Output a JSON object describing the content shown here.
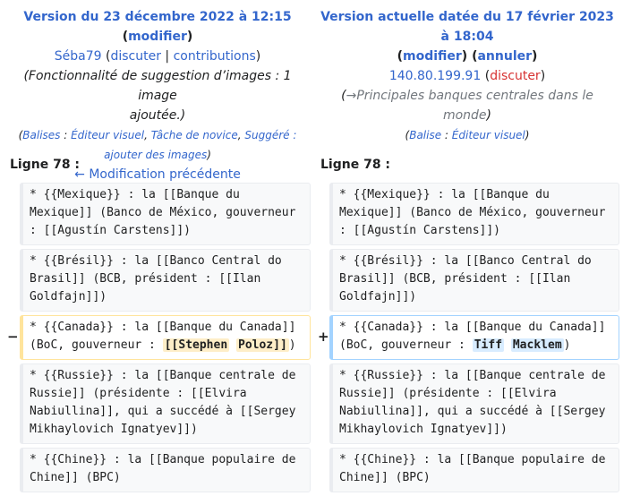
{
  "left": {
    "title_prefix": "Version du 23 décembre 2022 à 12:15",
    "modify": "modifier",
    "user": "Séba79",
    "discuss": "discuter",
    "separator": "|",
    "contributions": "contributions",
    "summary_part1": "(Fonctionnalité de suggestion d’images : 1 image",
    "summary_part2": "ajoutée.)",
    "tag_label": "Balises",
    "tag1": "Éditeur visuel",
    "tag2": "Tâche de novice",
    "tag3": "Suggéré :",
    "tag4": "ajouter des images",
    "prev_link": "← Modification précédente"
  },
  "right": {
    "title": "Version actuelle datée du 17 février 2023 à 18:04",
    "modify": "modifier",
    "undo": "annuler",
    "user": "140.80.199.91",
    "discuss": "discuter",
    "summary_arrow": "→",
    "summary": "Principales banques centrales dans le monde",
    "tag_label": "Balise",
    "tag1": "Éditeur visuel"
  },
  "line_label": "Ligne 78 :",
  "rows": {
    "mexique": "* {{Mexique}} : la [[Banque du Mexique]] (Banco de México, gouverneur : [[Agustín Carstens]])",
    "bresil": "* {{Brésil}} : la [[Banco Central do Brasil]] (BCB, président : [[Ilan Goldfajn]])",
    "canada_prefix": "* {{Canada}} : la [[Banque du Canada]] (BoC, gouverneur : ",
    "canada_old1": "[[Stephen",
    "canada_old2": "Poloz]]",
    "canada_new1": "Tiff",
    "canada_new2": "Macklem",
    "canada_suffix": ")",
    "russie": "* {{Russie}} : la [[Banque centrale de Russie]] (présidente : [[Elvira Nabiullina]], qui a succédé à [[Sergey Mikhaylovich Ignatyev]])",
    "chine": "* {{Chine}} : la [[Banque populaire de Chine]] (BPC)"
  },
  "markers": {
    "minus": "−",
    "plus": "+"
  }
}
